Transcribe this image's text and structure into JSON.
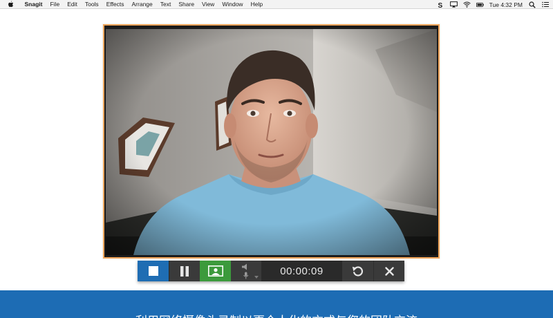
{
  "menubar": {
    "app_name": "Snagit",
    "items": [
      "File",
      "Edit",
      "Tools",
      "Effects",
      "Arrange",
      "Text",
      "Share",
      "View",
      "Window",
      "Help"
    ],
    "clock": "Tue 4:32 PM"
  },
  "recorder": {
    "timer": "00:00:09",
    "webcam_enabled": true,
    "accent_colors": {
      "stop": "#1f6db3",
      "webcam_on": "#3c9a3c",
      "frame_border": "#f2a65a"
    }
  },
  "banner": {
    "text": "利用网络摄像头录制以更个人化的方式与您的团队交流"
  }
}
